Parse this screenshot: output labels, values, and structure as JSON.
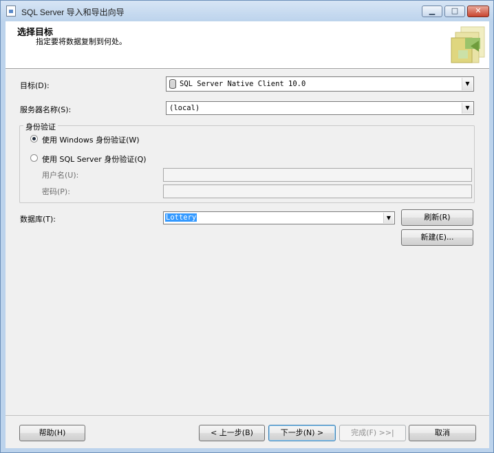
{
  "window": {
    "title": "SQL Server 导入和导出向导",
    "controls": {
      "minimize": "▭",
      "maximize": "□",
      "close": "X"
    }
  },
  "header": {
    "title": "选择目标",
    "subtitle": "指定要将数据复制到何处。"
  },
  "form": {
    "destination_label": "目标(D):",
    "destination_value": "SQL Server Native Client 10.0",
    "server_label": "服务器名称(S):",
    "server_value": "(local)",
    "auth_group_title": "身份验证",
    "windows_auth_label": "使用 Windows 身份验证(W)",
    "sql_auth_label": "使用 SQL Server 身份验证(Q)",
    "username_label": "用户名(U):",
    "password_label": "密码(P):",
    "username_value": "",
    "password_value": "",
    "database_label": "数据库(T):",
    "database_value": "Lottery",
    "refresh_button": "刷新(R)",
    "new_button": "新建(E)..."
  },
  "footer": {
    "help_button": "帮助(H)",
    "back_button": "< 上一步(B)",
    "next_button": "下一步(N) >",
    "finish_button": "完成(F) >>|",
    "cancel_button": "取消"
  },
  "icons": {
    "app": "document-icon",
    "header": "wizard-folder-icon",
    "provider": "database-icon"
  },
  "colors": {
    "selection": "#3399ff",
    "default_button_border": "#3c7fb1"
  }
}
